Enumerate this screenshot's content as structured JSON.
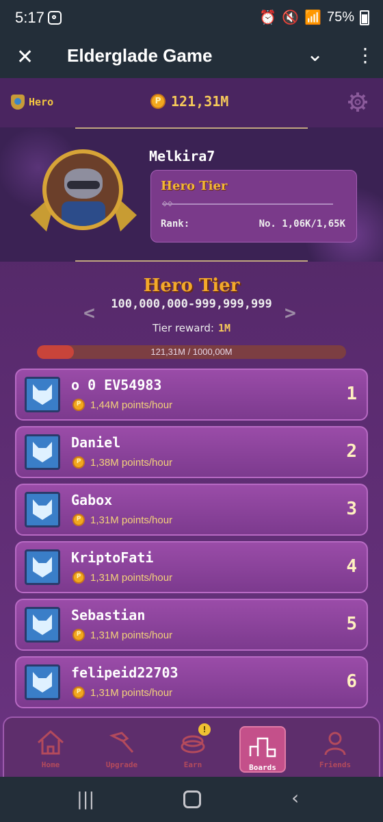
{
  "status_bar": {
    "time": "5:17",
    "battery": "75%"
  },
  "app_bar": {
    "title": "Elderglade Game"
  },
  "header": {
    "league": "Hero",
    "balance": "121,31M"
  },
  "profile": {
    "username": "Melkira7",
    "tier_label": "Hero Tier",
    "rank_label": "Rank:",
    "rank_value": "No. 1,06K/1,65K"
  },
  "tier": {
    "title": "Hero Tier",
    "range": "100,000,000-999,999,999",
    "reward_label": "Tier reward:",
    "reward_value": "1M",
    "progress_text": "121,31M / 1000,00M",
    "progress_fraction": 0.12
  },
  "leaderboard": [
    {
      "name": "o 0 EV54983",
      "points": "1,44M points/hour",
      "rank": "1"
    },
    {
      "name": "Daniel",
      "points": "1,38M points/hour",
      "rank": "2"
    },
    {
      "name": "Gabox",
      "points": "1,31M points/hour",
      "rank": "3"
    },
    {
      "name": "KriptoFati",
      "points": "1,31M points/hour",
      "rank": "4"
    },
    {
      "name": "Sebastian",
      "points": "1,31M points/hour",
      "rank": "5"
    },
    {
      "name": "felipeid22703",
      "points": "1,31M points/hour",
      "rank": "6"
    }
  ],
  "nav": [
    {
      "label": "Home",
      "icon": "home-icon"
    },
    {
      "label": "Upgrade",
      "icon": "hammer-icon"
    },
    {
      "label": "Earn",
      "icon": "coins-icon",
      "badge": "!"
    },
    {
      "label": "Boards",
      "icon": "podium-icon",
      "active": true
    },
    {
      "label": "Friends",
      "icon": "friends-icon"
    }
  ]
}
